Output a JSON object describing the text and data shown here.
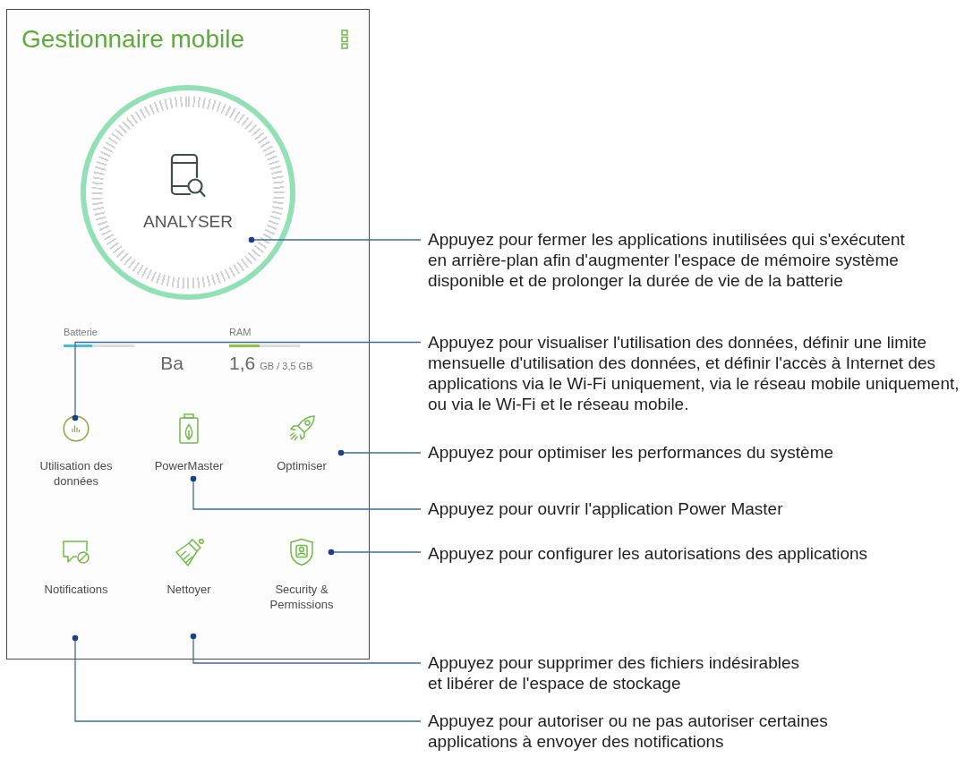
{
  "screen": {
    "title": "Gestionnaire mobile",
    "scan_button": {
      "label": "ANALYSER"
    },
    "meters": [
      {
        "label": "Batterie",
        "level": 0.4,
        "color": "#45c0dc",
        "value": "Ba"
      },
      {
        "label": "RAM",
        "level": 0.43,
        "color": "#8cc63f",
        "value": "1,6",
        "unit": "GB / 3,5 GB"
      }
    ],
    "tiles": [
      {
        "kind": "data",
        "label": "Utilisation des données"
      },
      {
        "kind": "power",
        "label": "PowerMaster"
      },
      {
        "kind": "boost",
        "label": "Optimiser"
      },
      {
        "kind": "notifications",
        "label": "Notifications"
      },
      {
        "kind": "clean",
        "label": "Nettoyer"
      },
      {
        "kind": "security",
        "label": "Security & Permissions"
      }
    ]
  },
  "callouts": [
    {
      "lines": [
        "Appuyez pour fermer les applications inutilisées qui s'exécutent",
        "en arrière-plan afin d'augmenter l'espace de mémoire système",
        "disponible et de prolonger la durée de vie de la batterie"
      ]
    },
    {
      "lines": [
        "Appuyez pour visualiser l'utilisation des données, définir une limite",
        "mensuelle d'utilisation des données, et définir l'accès à Internet des",
        "applications via le Wi-Fi uniquement, via le réseau mobile uniquement,",
        "ou via le Wi-Fi et le réseau mobile."
      ]
    },
    {
      "lines": [
        "Appuyez pour optimiser les performances du système"
      ]
    },
    {
      "lines": [
        "Appuyez pour ouvrir l'application Power Master"
      ]
    },
    {
      "lines": [
        "Appuyez pour configurer les autorisations des applications"
      ]
    },
    {
      "lines": [
        "Appuyez pour supprimer des fichiers indésirables",
        "et libérer de l'espace de stockage"
      ]
    },
    {
      "lines": [
        "Appuyez pour autoriser ou ne pas autoriser certaines",
        "applications à envoyer des notifications"
      ]
    }
  ]
}
